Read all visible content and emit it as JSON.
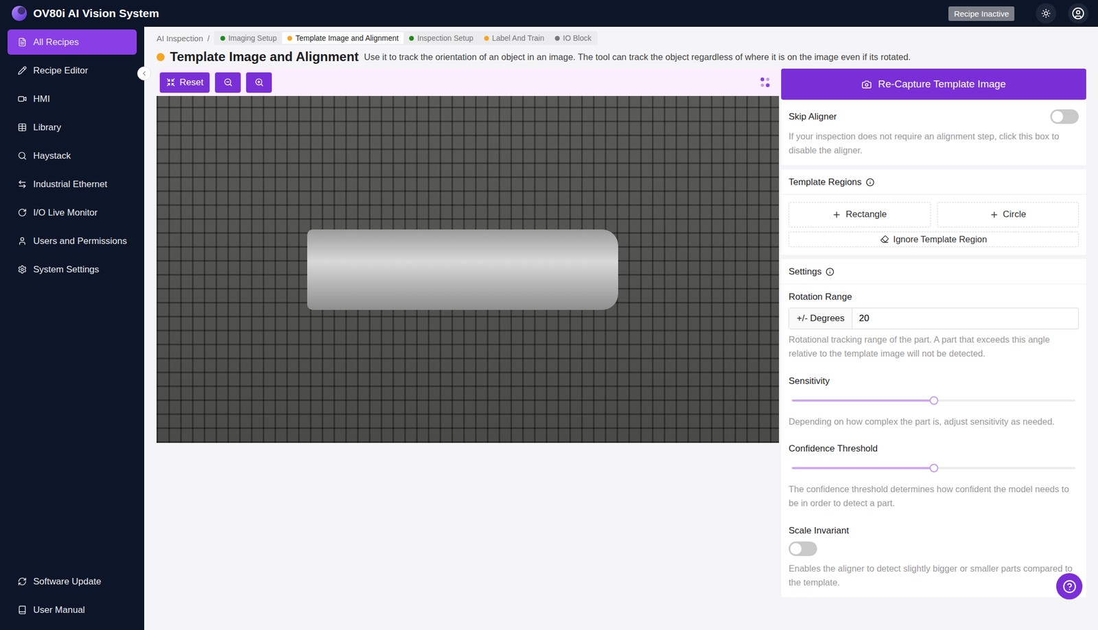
{
  "window": {
    "title": "OV80i AI Vision System",
    "status_badge": "Recipe Inactive"
  },
  "sidebar": {
    "items": [
      {
        "label": "All Recipes",
        "selected": true
      },
      {
        "label": "Recipe Editor",
        "selected": false
      },
      {
        "label": "HMI",
        "selected": false
      },
      {
        "label": "Library",
        "selected": false
      },
      {
        "label": "Haystack",
        "selected": false
      },
      {
        "label": "Industrial Ethernet",
        "selected": false
      },
      {
        "label": "I/O Live Monitor",
        "selected": false
      },
      {
        "label": "Users and Permissions",
        "selected": false
      },
      {
        "label": "System Settings",
        "selected": false
      }
    ],
    "bottom_items": [
      {
        "label": "Software Update"
      },
      {
        "label": "User Manual"
      }
    ]
  },
  "breadcrumb": {
    "root": "AI Inspection",
    "separator": "/",
    "steps": [
      {
        "label": "Imaging Setup",
        "color": "#1f8a1f",
        "selected": false
      },
      {
        "label": "Template Image and Alignment",
        "color": "#f5a524",
        "selected": true
      },
      {
        "label": "Inspection Setup",
        "color": "#1f8a1f",
        "selected": false
      },
      {
        "label": "Label And Train",
        "color": "#f5a524",
        "selected": false
      },
      {
        "label": "IO Block",
        "color": "#777777",
        "selected": false
      }
    ]
  },
  "page": {
    "title": "Template Image and Alignment",
    "status_color": "#f5a524",
    "description": "Use it to track the orientation of an object in an image. The tool can track the object regardless of where it is on the image even if its rotated."
  },
  "toolbar": {
    "reset": "Reset"
  },
  "panel": {
    "recapture": "Re-Capture Template Image",
    "skip_aligner": {
      "label": "Skip Aligner",
      "on": false,
      "help": "If your inspection does not require an alignment step, click this box to disable the aligner."
    },
    "template_regions": {
      "title": "Template Regions",
      "buttons": [
        "Rectangle",
        "Circle"
      ],
      "ignore": "Ignore Template Region"
    },
    "settings": {
      "title": "Settings",
      "rotation": {
        "label": "Rotation Range",
        "addon": "+/- Degrees",
        "value": "20",
        "help": "Rotational tracking range of the part. A part that exceeds this angle relative to the template image will not be detected."
      },
      "sensitivity": {
        "label": "Sensitivity",
        "level": 0.5,
        "help": "Depending on how complex the part is, adjust sensitivity as needed."
      },
      "confidence": {
        "label": "Confidence Threshold",
        "level": 0.5,
        "help": "The confidence threshold determines how confident the model needs to be in order to detect a part."
      },
      "scale_invariant": {
        "label": "Scale Invariant",
        "on": false,
        "help": "Enables the aligner to detect slightly bigger or smaller parts compared to the template."
      }
    }
  }
}
